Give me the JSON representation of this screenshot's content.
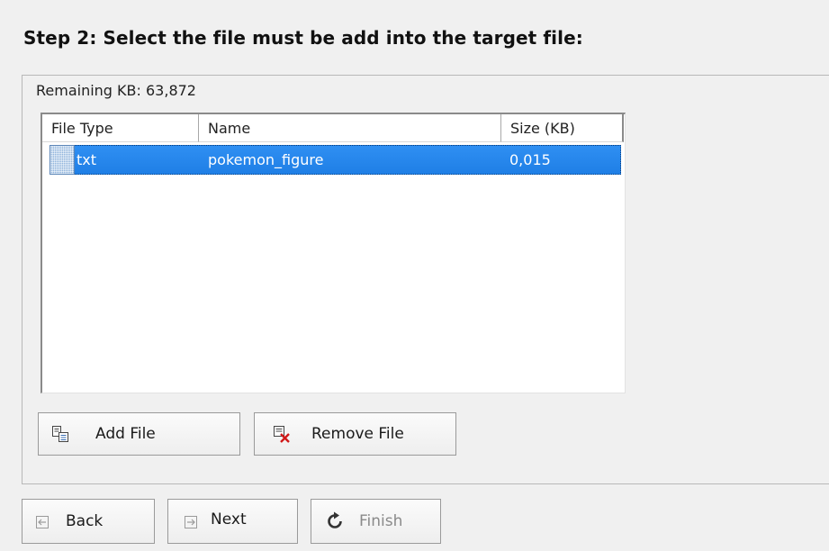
{
  "step_title": "Step 2: Select the file must be add into the target file:",
  "remaining_kb": "Remaining KB: 63,872",
  "file_list": {
    "columns": [
      "File Type",
      "Name",
      "Size (KB)"
    ],
    "rows": [
      {
        "file_type": "txt",
        "name": "pokemon_figure",
        "size": "0,015",
        "selected": true
      }
    ]
  },
  "buttons": {
    "add_file": "Add File",
    "remove_file": "Remove File",
    "back": "Back",
    "next": "Next",
    "finish": "Finish"
  },
  "icons": {
    "add_file": "add-file-icon",
    "remove_file": "remove-file-icon",
    "back": "back-arrow-icon",
    "next": "next-arrow-icon",
    "finish": "finish-refresh-icon",
    "row": "file-type-icon"
  },
  "colors": {
    "selection": "#3399ff",
    "background": "#f0f0f0",
    "remove_x": "#d01818"
  }
}
